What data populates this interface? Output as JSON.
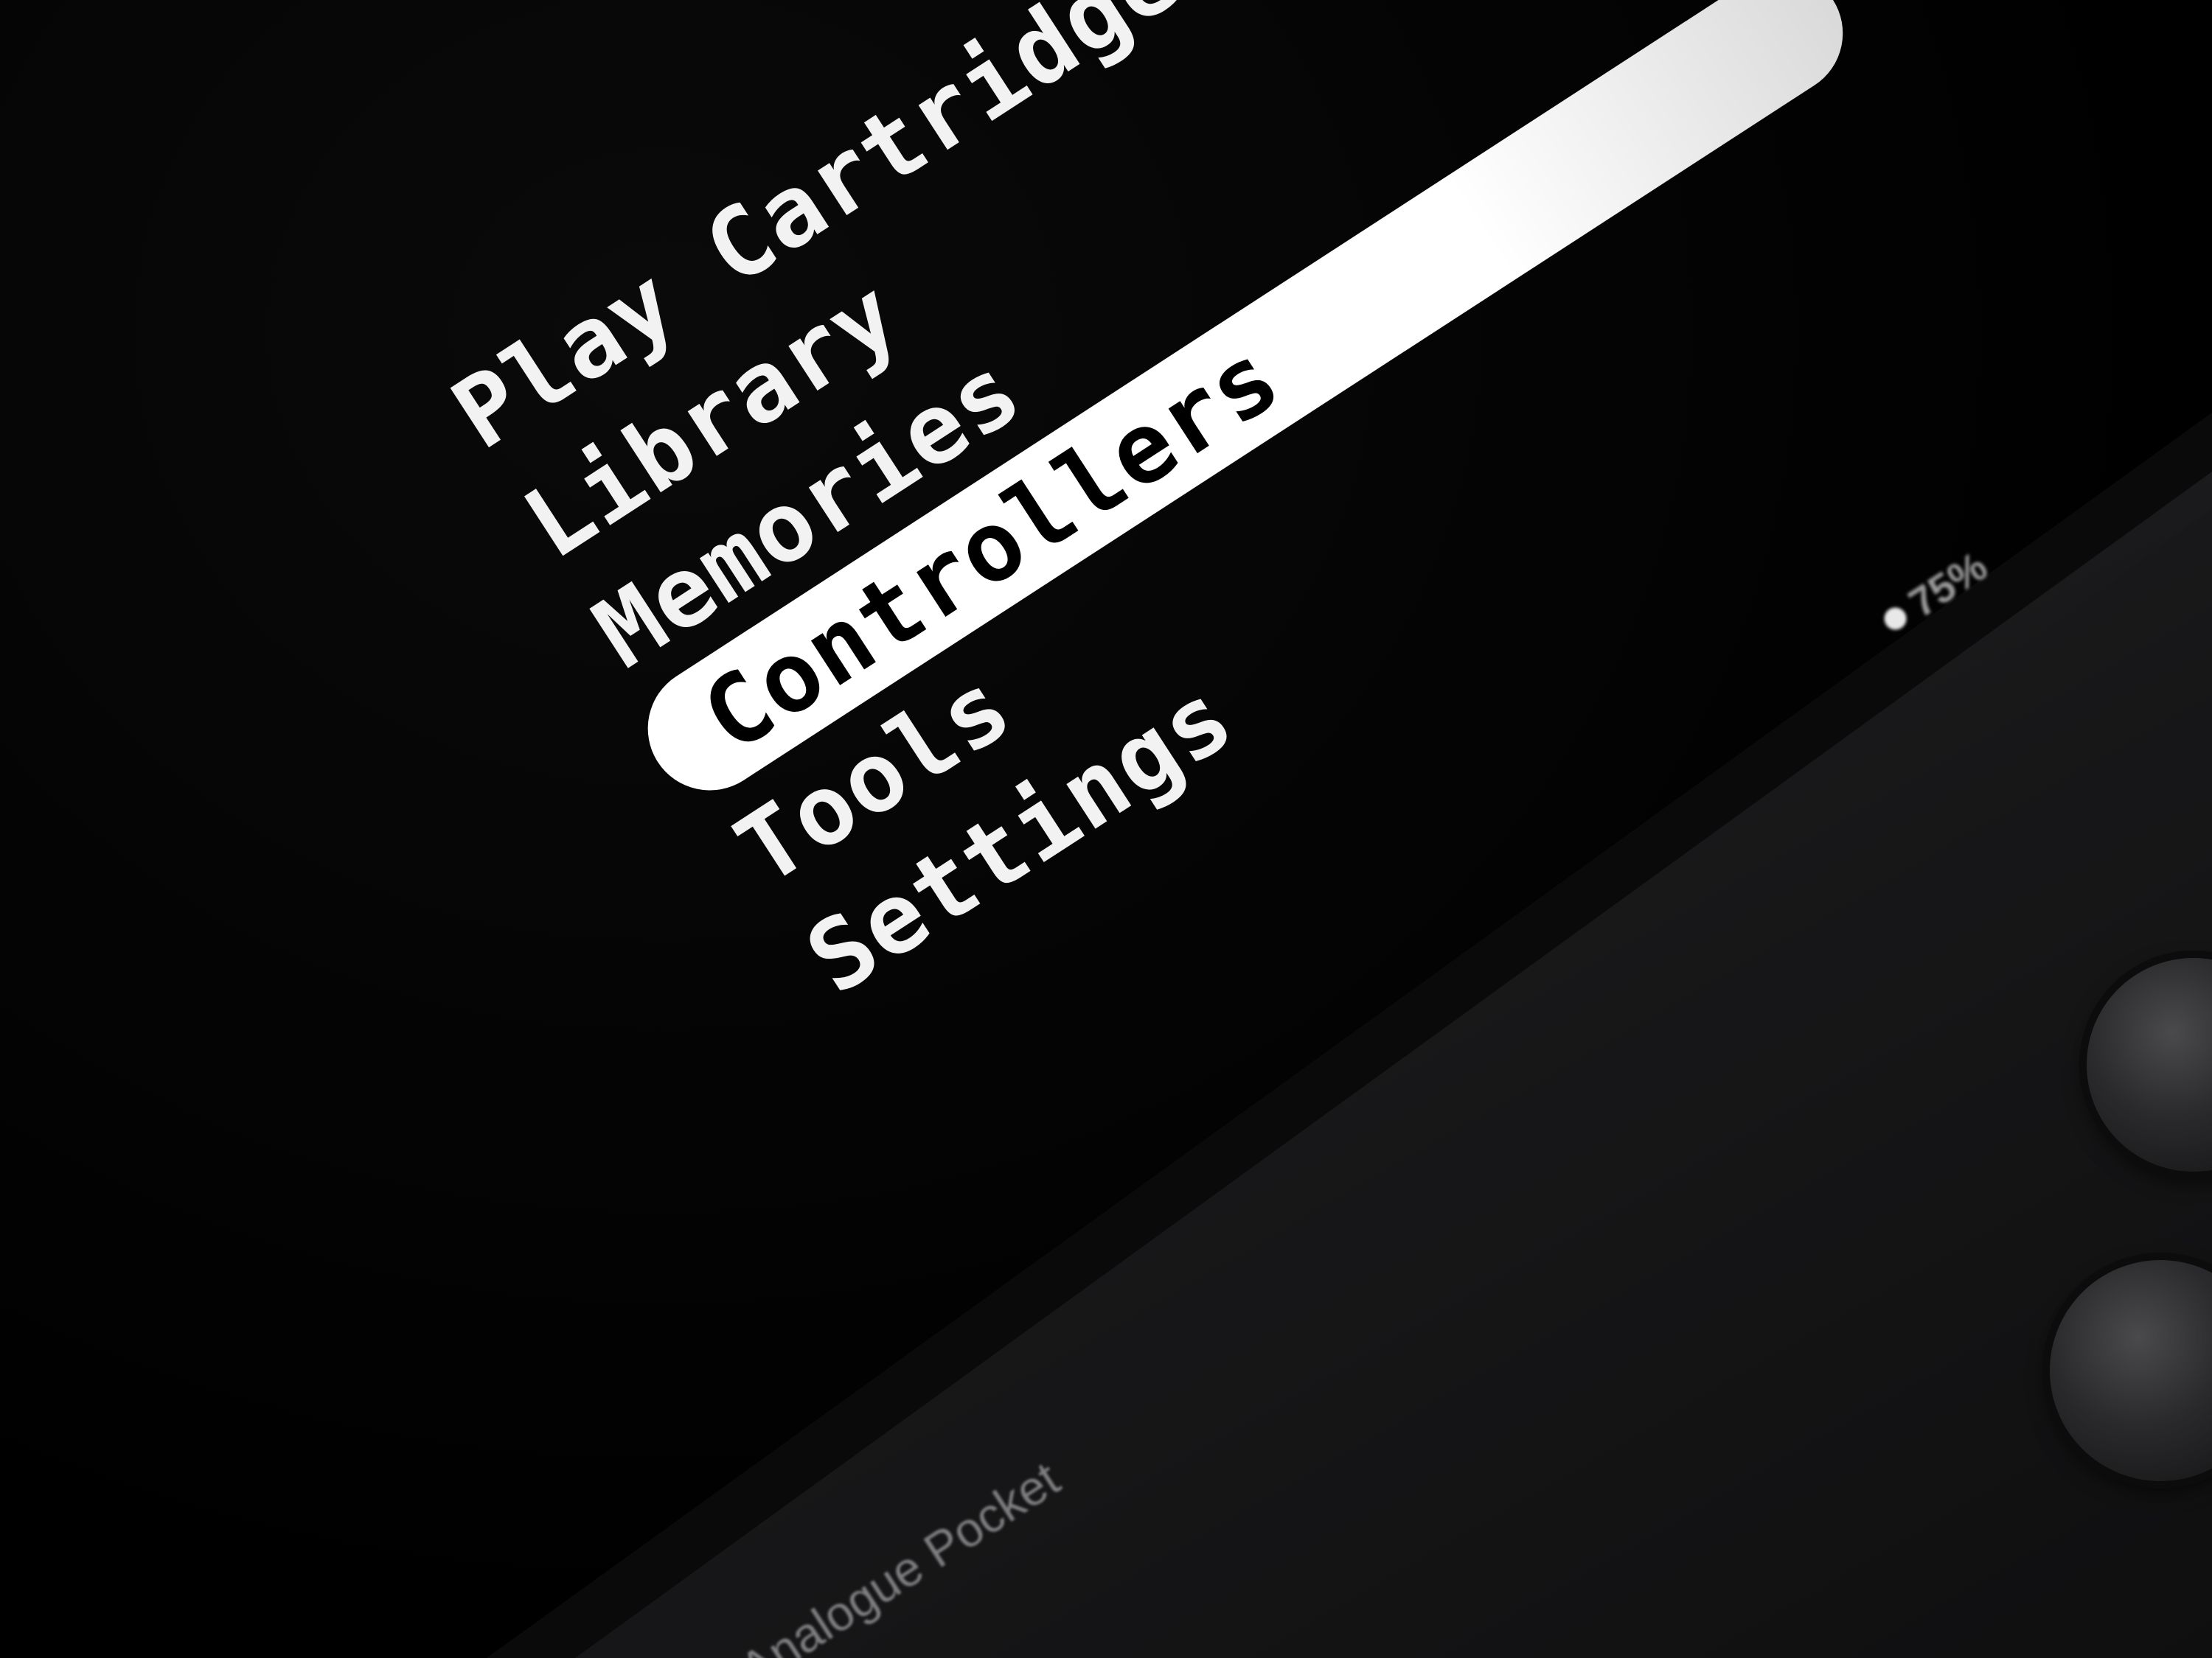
{
  "menu": {
    "items": [
      {
        "label": "Play Cartridge",
        "selected": false
      },
      {
        "label": "Library",
        "selected": false
      },
      {
        "label": "Memories",
        "selected": false
      },
      {
        "label": "Controllers",
        "selected": true
      },
      {
        "label": "Tools",
        "selected": false
      },
      {
        "label": "Settings",
        "selected": false
      }
    ]
  },
  "status": {
    "battery_text": "75%"
  },
  "device": {
    "brand": "Analogue Pocket"
  },
  "colors": {
    "screen_background": "#000000",
    "menu_text": "#f2f2f2",
    "highlight": "#ffffff",
    "device_body": "#1d1d1f"
  }
}
